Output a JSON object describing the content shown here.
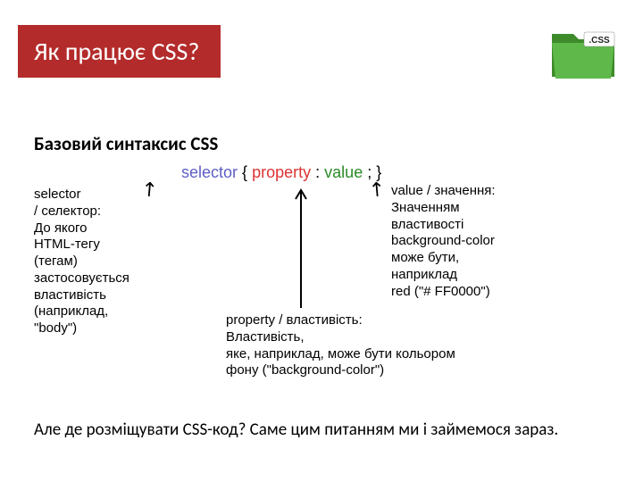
{
  "header": {
    "title": "Як працює CSS?"
  },
  "logo": {
    "label": ".CSS"
  },
  "subtitle": "Базовий синтаксис CSS",
  "syntax": {
    "selector": "selector",
    "open": "{",
    "property": "property",
    "colon": ":",
    "value": "value",
    "semi": ";",
    "close": "}"
  },
  "labels": {
    "selector": "selector\n/ селектор:\nДо якого\nHTML-тегу\n(тегам)\nзастосовується\nвластивість\n(наприклад,\n\"body\")",
    "property": "property / властивість:\nВластивість,\nяке, наприклад, може бути кольором\nфону (\"background-color\")",
    "value": "value / значення:\nЗначенням\nвластивості\nbackground-color\nможе бути,\nнаприклад\nred (\"# FF0000\")"
  },
  "footer": "Але де розміщувати CSS-код? Саме цим питанням ми і займемося зараз."
}
